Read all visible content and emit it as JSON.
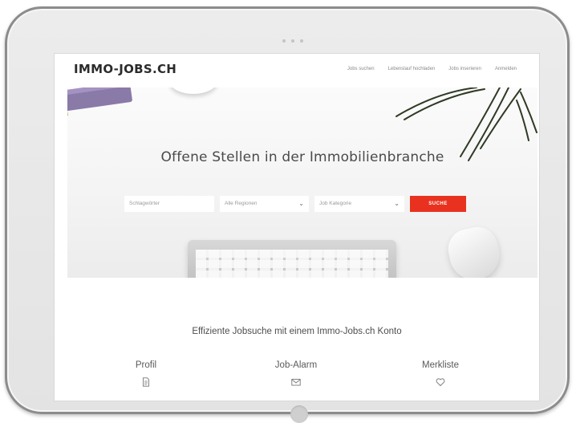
{
  "brand": "IMMO-JOBS.CH",
  "nav": {
    "links": [
      "Jobs suchen",
      "Lebenslauf hochladen",
      "Jobs inserieren",
      "Anmelden"
    ]
  },
  "hero": {
    "title": "Offene Stellen in der Immobilienbranche"
  },
  "search": {
    "keyword_placeholder": "Schlagwörter",
    "region_value": "Alle Regionen",
    "category_value": "Job Kategorie",
    "submit_label": "SUCHE"
  },
  "section": {
    "title": "Effiziente Jobsuche mit einem Immo-Jobs.ch Konto"
  },
  "features": [
    {
      "label": "Profil",
      "icon": "document-icon"
    },
    {
      "label": "Job-Alarm",
      "icon": "envelope-icon"
    },
    {
      "label": "Merkliste",
      "icon": "heart-icon"
    }
  ],
  "colors": {
    "accent": "#e8321f",
    "logo": "#2b2b2b",
    "text": "#4a4a4a"
  }
}
